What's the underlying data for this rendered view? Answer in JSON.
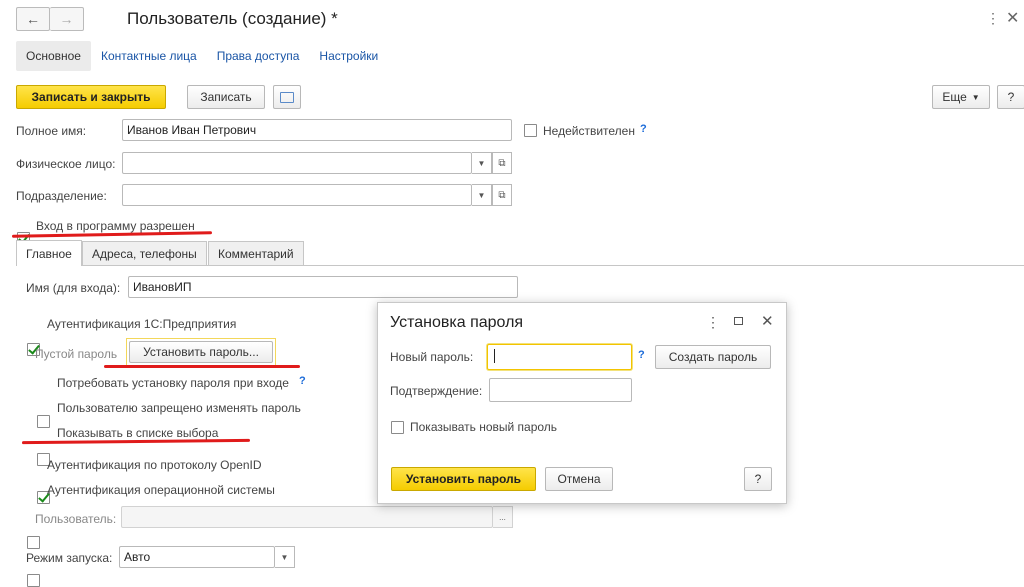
{
  "window": {
    "title": "Пользователь (создание) *",
    "menu_icon": "more-icon",
    "close_icon": "close-icon"
  },
  "top_tabs": [
    {
      "label": "Основное",
      "active": true
    },
    {
      "label": "Контактные лица",
      "active": false
    },
    {
      "label": "Права доступа",
      "active": false
    },
    {
      "label": "Настройки",
      "active": false
    }
  ],
  "toolbar": {
    "save_close": "Записать и закрыть",
    "save": "Записать",
    "more": "Еще",
    "help": "?"
  },
  "form": {
    "full_name_label": "Полное имя:",
    "full_name_value": "Иванов Иван Петрович",
    "inactive_label": "Недействителен",
    "inactive_help": "?",
    "person_label": "Физическое лицо:",
    "person_value": "",
    "dept_label": "Подразделение:",
    "dept_value": "",
    "login_allowed_label": "Вход в программу разрешен"
  },
  "inner_tabs": [
    {
      "label": "Главное",
      "active": true
    },
    {
      "label": "Адреса, телефоны",
      "active": false
    },
    {
      "label": "Комментарий",
      "active": false
    }
  ],
  "main_tab": {
    "login_label": "Имя (для входа):",
    "login_value": "ИвановИП",
    "auth_1c_label": "Аутентификация 1С:Предприятия",
    "empty_password_label": "Пустой пароль",
    "set_password_button": "Установить пароль...",
    "require_password_label": "Потребовать установку пароля при входе",
    "require_password_help": "?",
    "forbid_change_label": "Пользователю запрещено изменять пароль",
    "show_in_list_label": "Показывать в списке выбора",
    "openid_label": "Аутентификация по протоколу OpenID",
    "os_auth_label": "Аутентификация операционной системы",
    "os_user_label": "Пользователь:",
    "os_user_value": "",
    "os_user_btn": "...",
    "launch_mode_label": "Режим запуска:",
    "launch_mode_value": "Авто"
  },
  "dialog": {
    "title": "Установка пароля",
    "new_password_label": "Новый пароль:",
    "new_password_value": "",
    "new_password_help": "?",
    "generate_button": "Создать пароль",
    "confirm_label": "Подтверждение:",
    "confirm_value": "",
    "show_password_label": "Показывать новый пароль",
    "set_button": "Установить пароль",
    "cancel_button": "Отмена",
    "help_button": "?"
  },
  "colors": {
    "accent_yellow": "#f5cc00",
    "link_blue": "#1a55a6",
    "annotation_red": "#e01b1b",
    "check_green": "#1a8a1a"
  }
}
